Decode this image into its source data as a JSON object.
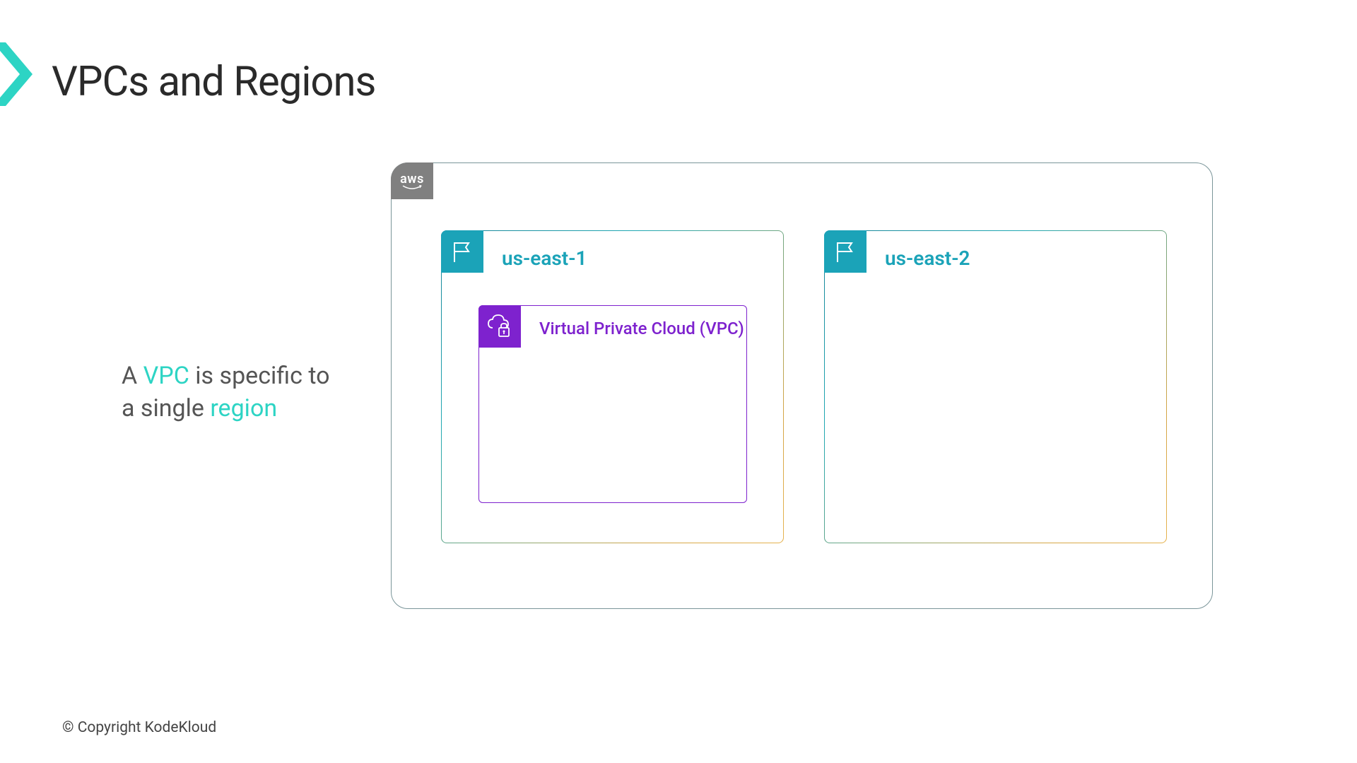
{
  "title": "VPCs and Regions",
  "description": {
    "prefix": "A ",
    "vpc": "VPC",
    "middle": " is specific to a single ",
    "region": "region"
  },
  "aws": {
    "label": "aws"
  },
  "regions": [
    {
      "name": "us-east-1",
      "has_vpc": true
    },
    {
      "name": "us-east-2",
      "has_vpc": false
    }
  ],
  "vpc": {
    "label": "Virtual Private Cloud (VPC)"
  },
  "copyright": "© Copyright KodeKloud"
}
